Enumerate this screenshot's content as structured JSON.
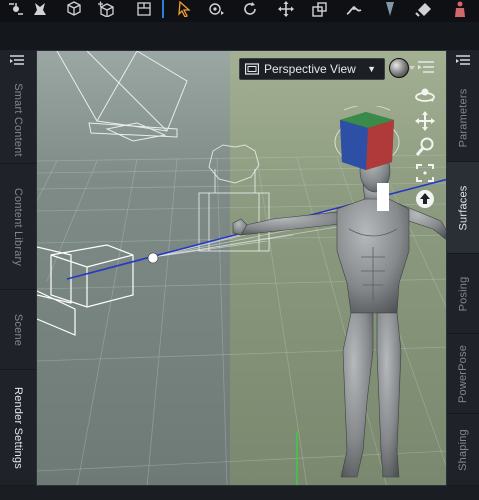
{
  "toolbar": {
    "icons": [
      "node-icon",
      "figure-tool-icon",
      "cube-icon",
      "add-cube-icon",
      "select-cube-icon",
      "pointer-icon",
      "universal-icon",
      "rotate-icon",
      "translate-icon",
      "scale-icon",
      "joint-editor-icon",
      "geometry-icon",
      "surface-icon",
      "figure-icon"
    ]
  },
  "left_tabs": [
    {
      "label": "Smart Content",
      "active": false
    },
    {
      "label": "Content Library",
      "active": false
    },
    {
      "label": "Scene",
      "active": false
    },
    {
      "label": "Render Settings",
      "active": false
    }
  ],
  "right_tabs": [
    {
      "label": "Parameters",
      "active": false
    },
    {
      "label": "Surfaces",
      "active": true
    },
    {
      "label": "Posing",
      "active": false
    },
    {
      "label": "PowerPose",
      "active": false
    },
    {
      "label": "Shaping",
      "active": false
    }
  ],
  "viewport": {
    "camera_label": "Perspective View",
    "nav_controls": [
      "orbit-icon",
      "pan-icon",
      "zoom-icon",
      "frame-icon",
      "reset-icon"
    ]
  },
  "colors": {
    "accent": "#2f7fd8",
    "viewport_left": "#7f8c86",
    "viewport_right": "#8e9b7f",
    "cube_red": "#b03a3a",
    "cube_green": "#3a8a4a",
    "cube_blue": "#2e4fa6",
    "figure_gray": "#8a8d8f",
    "ray_blue": "#2636c8"
  }
}
